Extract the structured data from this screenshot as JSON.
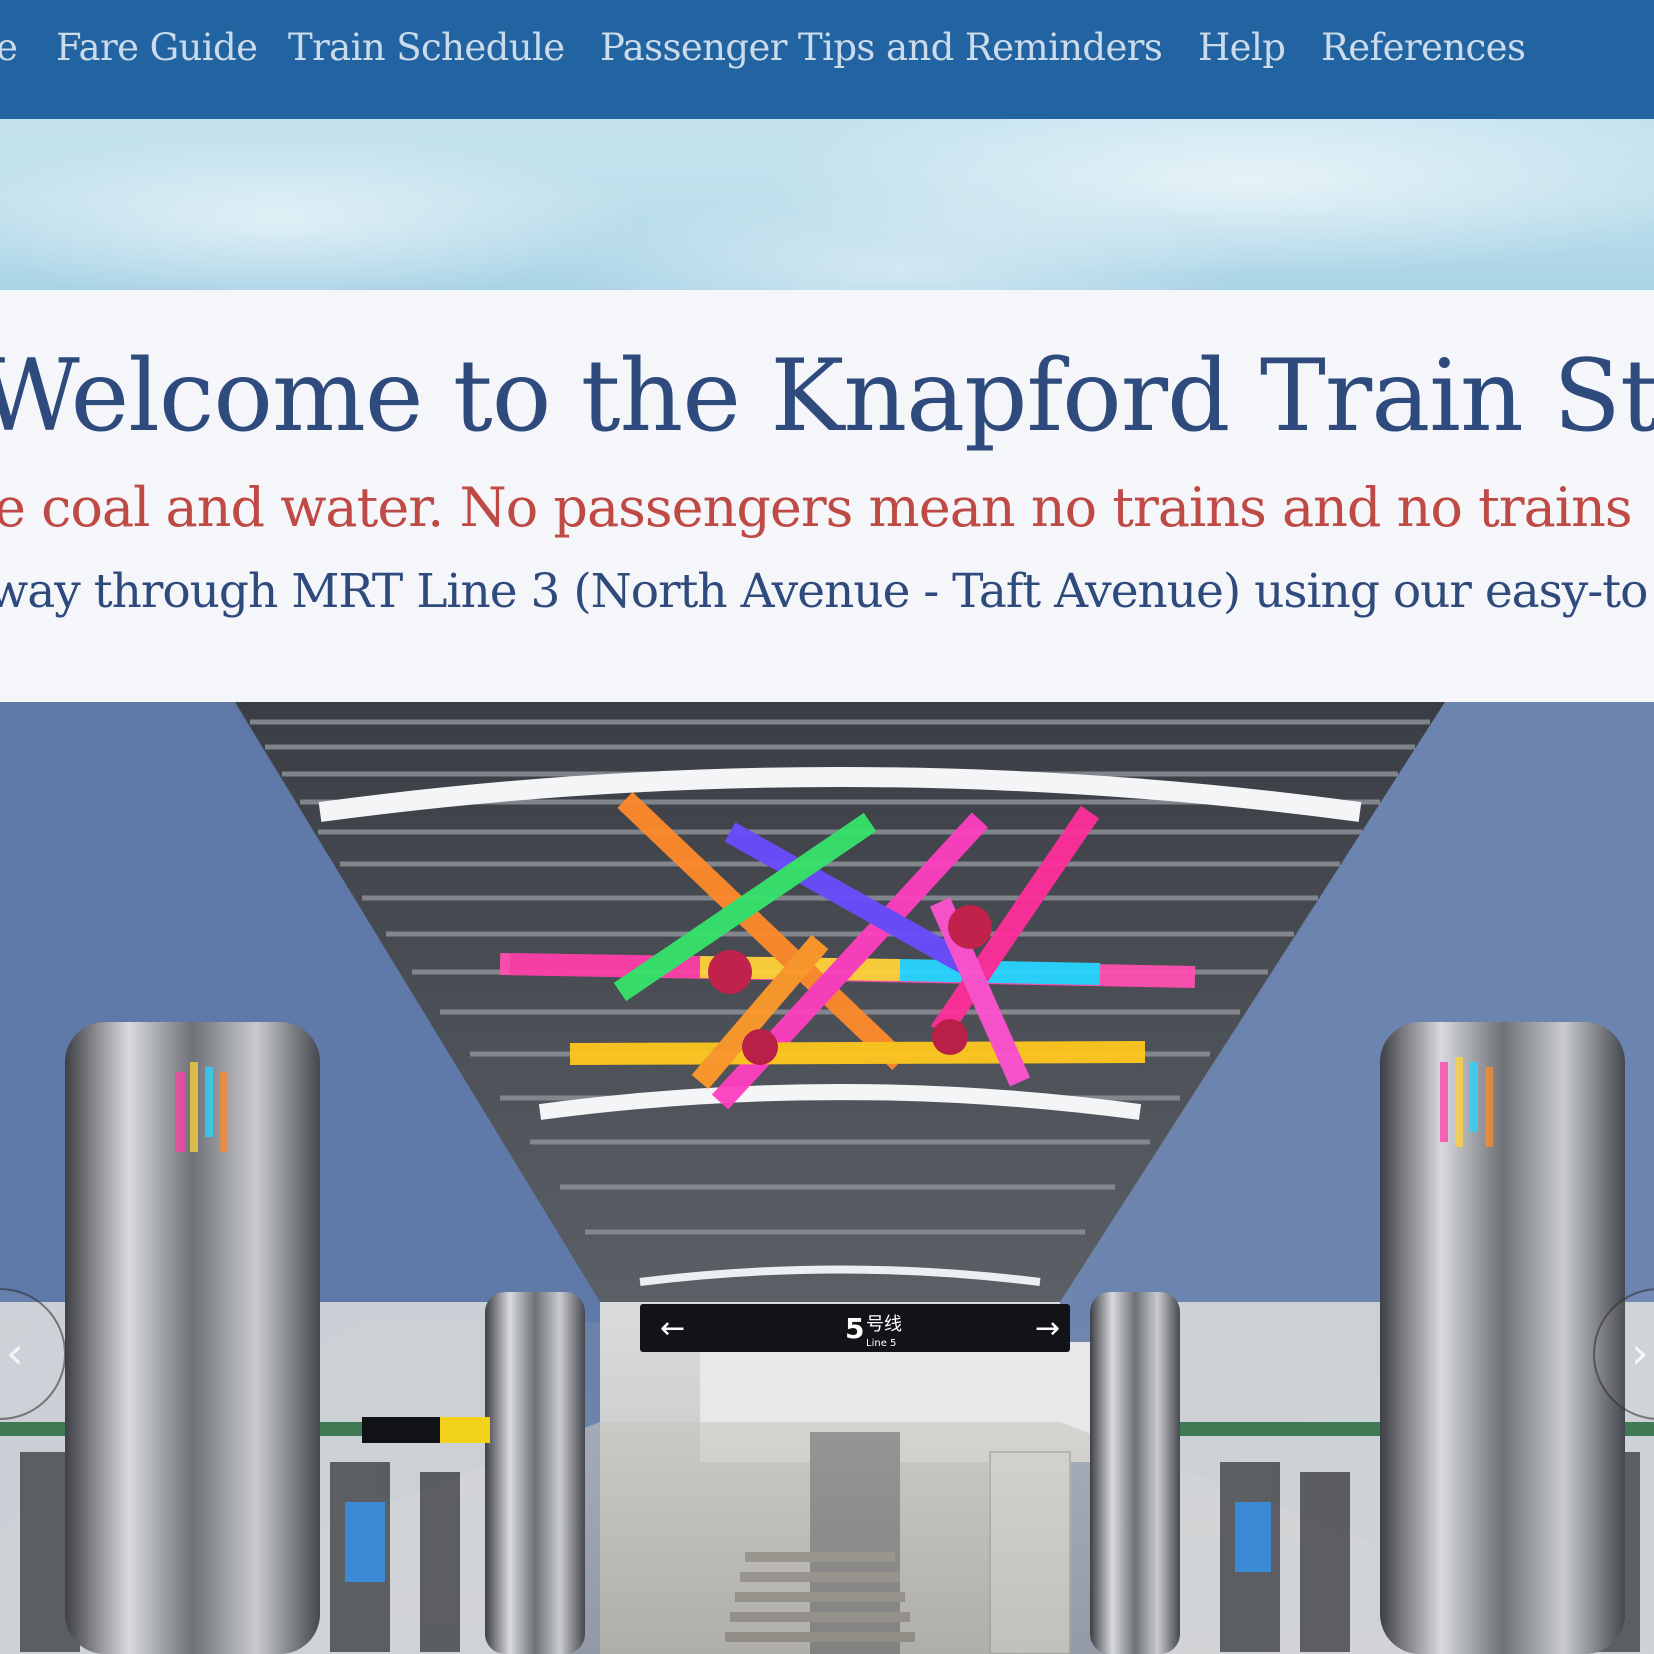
{
  "nav": {
    "items": [
      {
        "label": "e"
      },
      {
        "label": "Fare Guide"
      },
      {
        "label": "Train Schedule"
      },
      {
        "label": "Passenger Tips and Reminders"
      },
      {
        "label": "Help"
      },
      {
        "label": "References"
      }
    ]
  },
  "welcome": {
    "title": "Welcome to the Knapford Train Station",
    "subtitle": "e coal and water. No passengers mean no trains and no trains",
    "description": "way through MRT Line 3 (North Avenue - Taft Avenue) using our easy-to"
  },
  "hero": {
    "sign": {
      "line_number": "5",
      "line_chinese": "号线",
      "line_english": "Line 5"
    },
    "carousel": {
      "prev_icon": "chevron-left-icon",
      "next_icon": "chevron-right-icon"
    }
  },
  "colors": {
    "nav_bg": "#2263a2",
    "nav_text": "#ccdbea",
    "title": "#2f4a7c",
    "subtitle": "#bf4a45"
  }
}
